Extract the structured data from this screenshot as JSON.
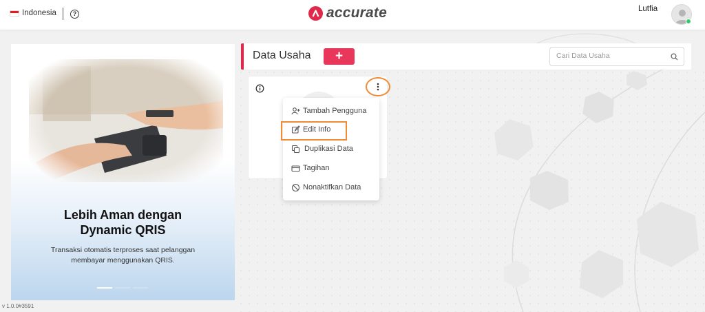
{
  "header": {
    "language": "Indonesia",
    "help_icon": "help-circle-icon",
    "logo_text": "accurate",
    "username": "Lutfia"
  },
  "promo": {
    "title_line1": "Lebih Aman dengan",
    "title_line2": "Dynamic QRIS",
    "subtitle_line1": "Transaksi otomatis terproses saat pelanggan",
    "subtitle_line2": "membayar menggunakan QRIS.",
    "carousel_slides": 3,
    "active_slide": 1
  },
  "version": "v 1.0.0#3591",
  "data_usaha": {
    "title": "Data Usaha",
    "add_button_label": "+",
    "search_placeholder": "Cari Data Usaha"
  },
  "menu": {
    "items": [
      {
        "label": "Tambah Pengguna",
        "icon": "user-plus-icon"
      },
      {
        "label": "Edit Info",
        "icon": "edit-icon"
      },
      {
        "label": "Duplikasi Data",
        "icon": "copy-icon"
      },
      {
        "label": "Tagihan",
        "icon": "credit-card-icon"
      },
      {
        "label": "Nonaktifkan Data",
        "icon": "ban-icon"
      }
    ]
  },
  "colors": {
    "brand": "#e0284a",
    "add_button": "#e8375a",
    "highlight": "#ef8a35",
    "online": "#36c96b"
  }
}
